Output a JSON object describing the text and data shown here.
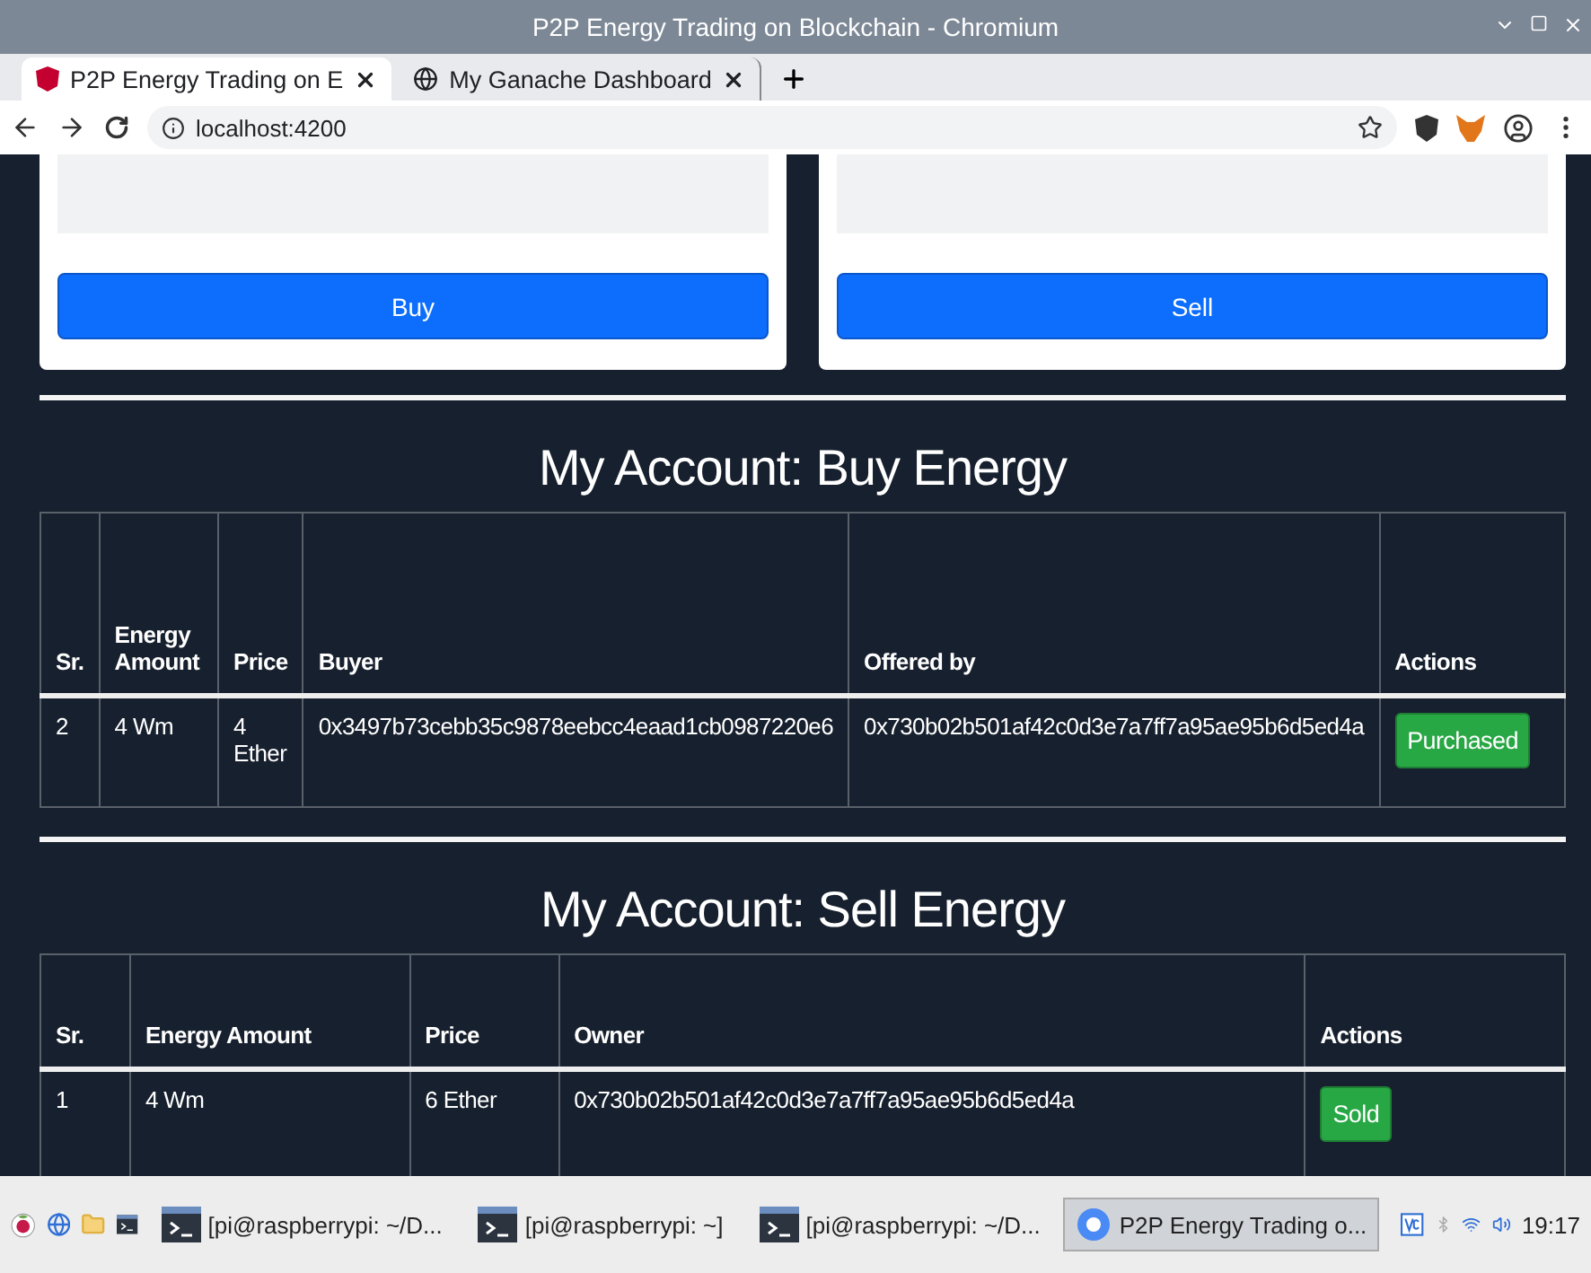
{
  "window": {
    "title": "P2P Energy Trading on Blockchain - Chromium"
  },
  "tabs": [
    {
      "label": "P2P Energy Trading on E",
      "selected": true,
      "kind": "shield"
    },
    {
      "label": "My Ganache Dashboard",
      "selected": false,
      "kind": "globe"
    }
  ],
  "address_bar": {
    "url": "localhost:4200"
  },
  "trade_cards": [
    {
      "button": "Buy"
    },
    {
      "button": "Sell"
    }
  ],
  "buy_section": {
    "heading": "My Account: Buy Energy",
    "columns": [
      "Sr.",
      "Energy Amount",
      "Price",
      "Buyer",
      "Offered by",
      "Actions"
    ],
    "rows": [
      {
        "cells": [
          "2",
          "4 Wm",
          "4 Ether",
          "0x3497b73cebb35c9878eebcc4eaad1cb0987220e6",
          "0x730b02b501af42c0d3e7a7ff7a95ae95b6d5ed4a"
        ],
        "action": "Purchased"
      }
    ]
  },
  "sell_section": {
    "heading": "My Account: Sell Energy",
    "columns": [
      "Sr.",
      "Energy Amount",
      "Price",
      "Owner",
      "Actions"
    ],
    "rows": [
      {
        "cells": [
          "1",
          "4 Wm",
          "6 Ether",
          "0x730b02b501af42c0d3e7a7ff7a95ae95b6d5ed4a"
        ],
        "action": "Sold"
      }
    ]
  },
  "taskbar": {
    "tasks": [
      {
        "label": "[pi@raspberrypi: ~/D...",
        "selected": false,
        "kind": "terminal"
      },
      {
        "label": "[pi@raspberrypi: ~]",
        "selected": false,
        "kind": "terminal"
      },
      {
        "label": "[pi@raspberrypi: ~/D...",
        "selected": false,
        "kind": "terminal"
      },
      {
        "label": "P2P Energy Trading o...",
        "selected": true,
        "kind": "browser"
      }
    ],
    "clock": "19:17"
  }
}
